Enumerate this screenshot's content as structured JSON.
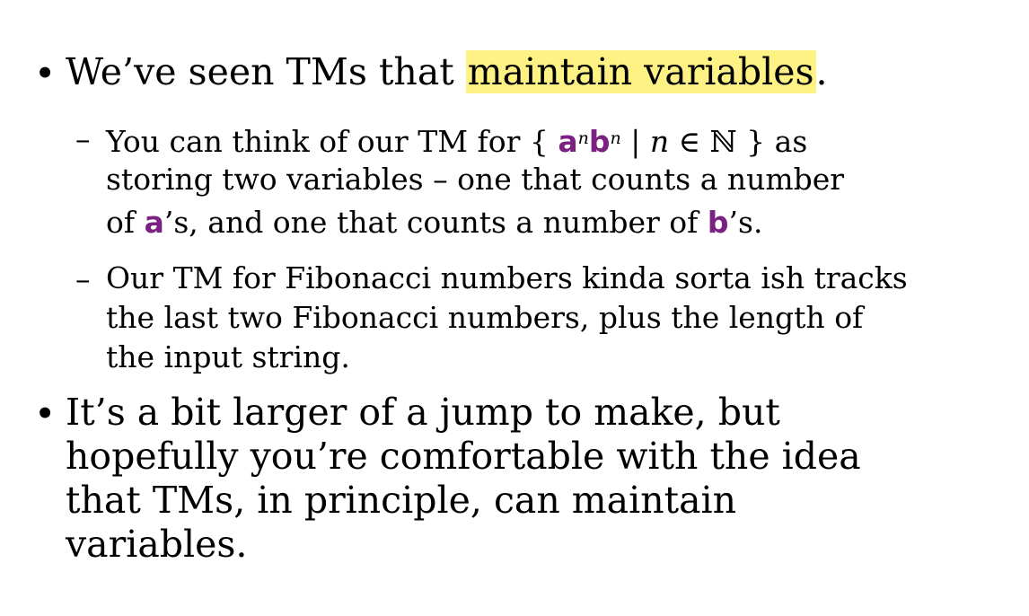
{
  "bullet_1": {
    "marker": "•",
    "prefix": "We’ve seen TMs that ",
    "highlight": "maintain variables",
    "suffix": "."
  },
  "sub_1": {
    "marker": "–",
    "prefix": "You can think of our TM for { ",
    "sym_a": "a",
    "sup_1": "n",
    "sym_b": "b",
    "sup_2": "n",
    "bar": " | ",
    "var_n": "n",
    "set_tail": " ∈ ℕ } as",
    "line_2": "storing two variables – one that counts a number",
    "line_3_pre": "of ",
    "line_3_a": "a",
    "line_3_mid": "’s, and one that counts a number of ",
    "line_3_b": "b",
    "line_3_post": "’s."
  },
  "sub_2": {
    "marker": "–",
    "text": "Our TM for Fibonacci numbers kinda sorta ish tracks the last two Fibonacci numbers, plus the length of the input string."
  },
  "bullet_2": {
    "marker": "•",
    "text": "It’s a bit larger of a jump to make, but hopefully you’re comfortable with the idea that TMs, in principle, can maintain variables."
  },
  "colors": {
    "highlight": "#fff284",
    "symbol": "#7a2182"
  }
}
